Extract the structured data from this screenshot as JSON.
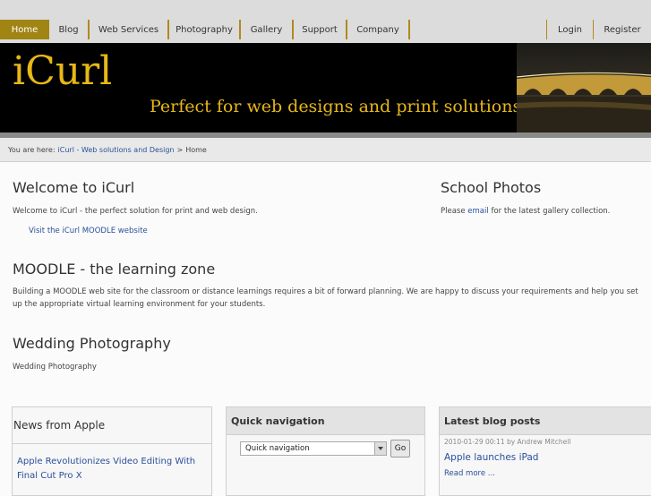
{
  "nav": {
    "items": [
      "Home",
      "Blog",
      "Web Services",
      "Photography",
      "Gallery",
      "Support",
      "Company"
    ],
    "login": "Login",
    "register": "Register"
  },
  "banner": {
    "logo": "iCurl",
    "tagline": "Perfect for web designs and print solutions"
  },
  "breadcrumb": {
    "prefix": "You are here:",
    "link": "iCurl - Web solutions and Design",
    "separator": ">",
    "current": "Home"
  },
  "main": {
    "welcome_title": "Welcome to iCurl",
    "welcome_text": "Welcome to iCurl - the perfect solution for print and web design.",
    "moodle_link": "Visit the iCurl MOODLE website",
    "moodle_title": "MOODLE - the learning zone",
    "moodle_text": "Building a MOODLE web site for the classroom or distance learnings requires a bit of forward planning. We are happy to discuss your requirements and help you set up the appropriate virtual learning environment for your students.",
    "wedding_title": "Wedding Photography",
    "wedding_text": "Wedding Photography"
  },
  "side": {
    "title": "School Photos",
    "text_before": "Please",
    "email_link": "email",
    "text_after": "for the latest gallery collection."
  },
  "news": {
    "title": "News from Apple",
    "item": "Apple Revolutionizes Video Editing With Final Cut Pro X"
  },
  "quicknav": {
    "title": "Quick navigation",
    "selected": "Quick navigation",
    "go": "Go"
  },
  "blog": {
    "title": "Latest blog posts",
    "meta": "2010-01-29 00:11 by Andrew Mitchell",
    "post": "Apple launches iPad",
    "more": "Read more ..."
  }
}
